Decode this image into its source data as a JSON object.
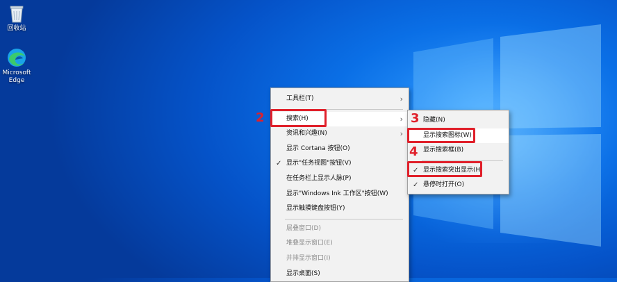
{
  "desktop": {
    "icons": [
      {
        "label": "回收站",
        "icon": "recycle-bin-icon"
      },
      {
        "label": "Microsoft Edge",
        "icon": "edge-icon"
      }
    ]
  },
  "taskbar_menu": {
    "items": [
      {
        "label": "工具栏(T)",
        "submenu": true
      },
      {
        "label": "搜索(H)",
        "submenu": true,
        "highlight": true
      },
      {
        "label": "资讯和兴趣(N)",
        "submenu": true
      },
      {
        "label": "显示 Cortana 按钮(O)"
      },
      {
        "label": "显示\"任务视图\"按钮(V)",
        "checked": true
      },
      {
        "label": "在任务栏上显示人脉(P)"
      },
      {
        "label": "显示\"Windows Ink 工作区\"按钮(W)"
      },
      {
        "label": "显示触摸键盘按钮(Y)"
      },
      {
        "label": "层叠窗口(D)",
        "disabled": true
      },
      {
        "label": "堆叠显示窗口(E)",
        "disabled": true
      },
      {
        "label": "并排显示窗口(I)",
        "disabled": true
      },
      {
        "label": "显示桌面(S)"
      }
    ]
  },
  "search_submenu": {
    "items": [
      {
        "label": "隐藏(N)"
      },
      {
        "label": "显示搜索图标(W)",
        "highlight": true
      },
      {
        "label": "显示搜索框(B)"
      },
      {
        "label": "显示搜索突出显示(H)",
        "checked": true
      },
      {
        "label": "悬停时打开(O)",
        "checked": true
      }
    ]
  },
  "annotations": {
    "step2": "2",
    "step3": "3",
    "step4": "4"
  },
  "colors": {
    "annotation": "#e0202a",
    "menu_bg": "#f2f2f2",
    "wallpaper": "#0a6fe6"
  }
}
